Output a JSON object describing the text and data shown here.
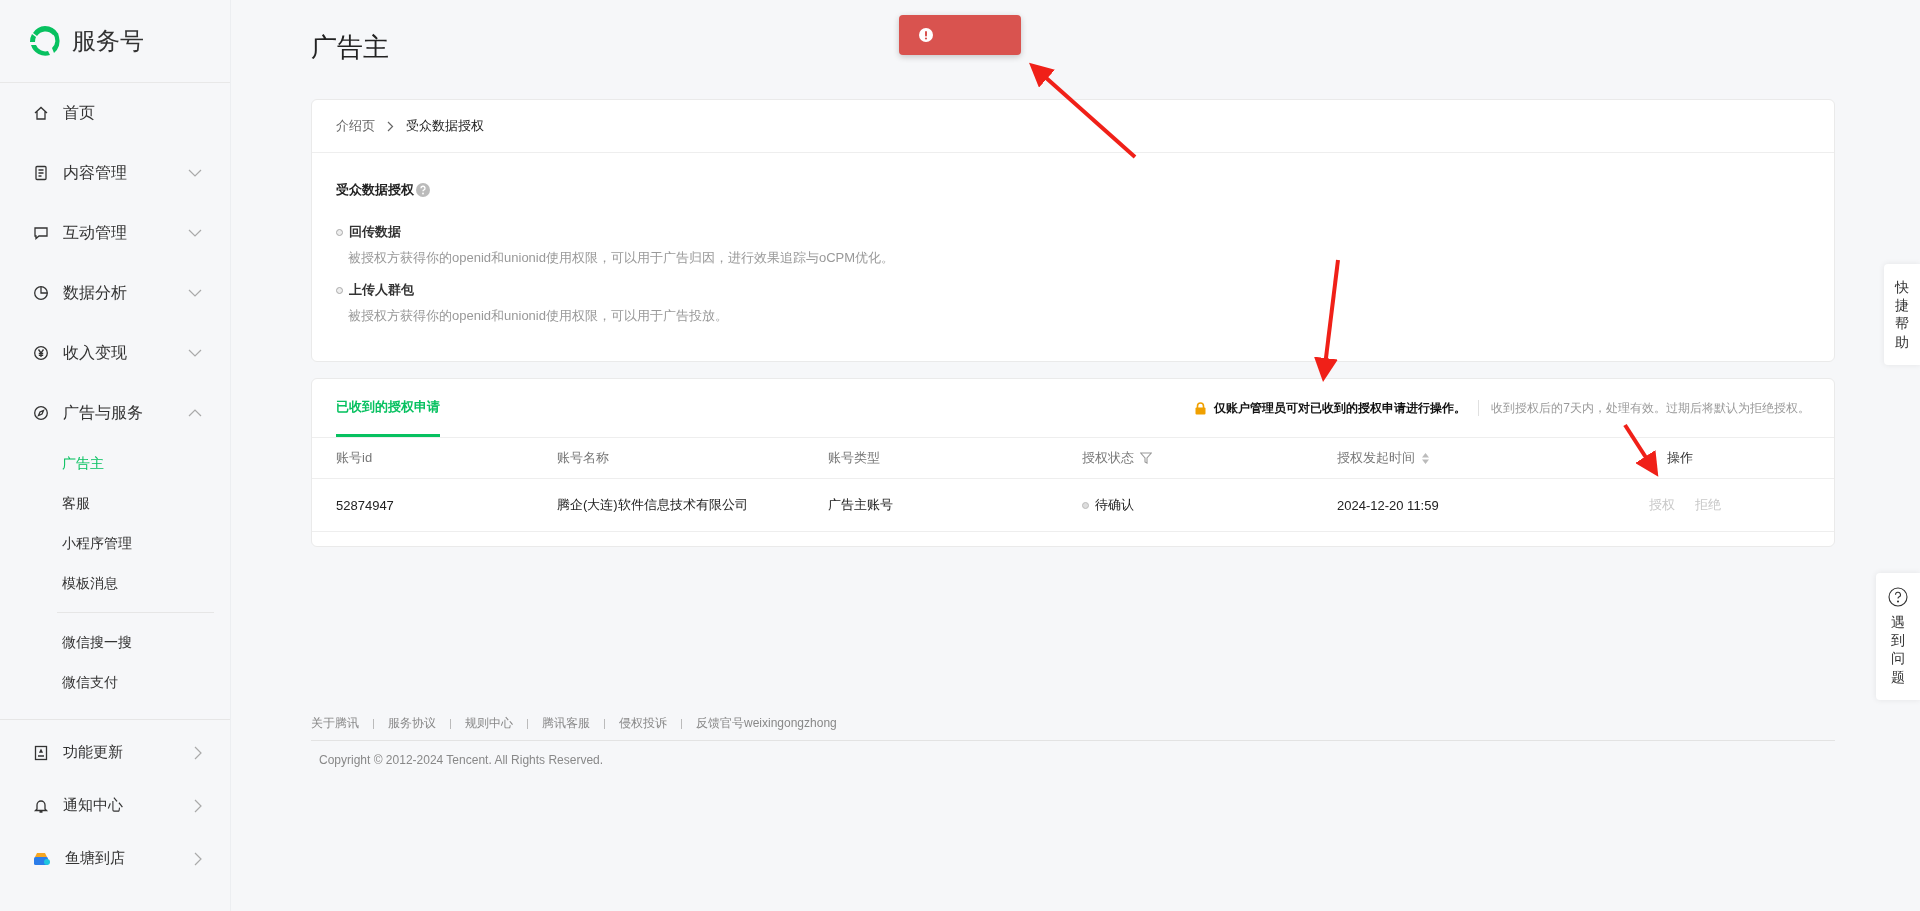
{
  "sidebar": {
    "logo": "服务号",
    "items": [
      {
        "label": "首页"
      },
      {
        "label": "内容管理",
        "expanded": false
      },
      {
        "label": "互动管理",
        "expanded": false
      },
      {
        "label": "数据分析",
        "expanded": false
      },
      {
        "label": "收入变现",
        "expanded": false
      },
      {
        "label": "广告与服务",
        "expanded": true,
        "children": [
          {
            "label": "广告主",
            "selected": true
          },
          {
            "label": "客服",
            "selected": false
          },
          {
            "label": "小程序管理",
            "selected": false
          },
          {
            "label": "模板消息",
            "selected": false
          },
          {
            "label": "微信搜一搜",
            "selected": false,
            "separated": true
          },
          {
            "label": "微信支付",
            "selected": false
          }
        ]
      }
    ],
    "bottom": [
      {
        "label": "功能更新"
      },
      {
        "label": "通知中心"
      },
      {
        "label": "鱼塘到店"
      }
    ]
  },
  "page_title": "广告主",
  "toast": {
    "kind": "error"
  },
  "intro_card": {
    "breadcrumb": [
      "介绍页",
      "受众数据授权"
    ],
    "heading": "受众数据授权",
    "points": [
      {
        "title": "回传数据",
        "text": "被授权方获得你的openid和unionid使用权限，可以用于广告归因，进行效果追踪与oCPM优化。"
      },
      {
        "title": "上传人群包",
        "text": "被授权方获得你的openid和unionid使用权限，可以用于广告投放。"
      }
    ]
  },
  "requests": {
    "tabs": [
      {
        "label": "已收到的授权申请",
        "selected": true
      }
    ],
    "notice": "仅账户管理员可对已收到的授权申请进行操作。",
    "hint": "收到授权后的7天内，处理有效。过期后将默认为拒绝授权。",
    "columns": [
      {
        "label": "账号id",
        "kind": "plain"
      },
      {
        "label": "账号名称",
        "kind": "plain"
      },
      {
        "label": "账号类型",
        "kind": "plain"
      },
      {
        "label": "授权状态",
        "kind": "filter"
      },
      {
        "label": "授权发起时间",
        "kind": "sort"
      },
      {
        "label": "操作",
        "kind": "plain"
      }
    ],
    "rows": [
      {
        "id": "52874947",
        "name": "腾企(大连)软件信息技术有限公司",
        "type": "广告主账号",
        "status": "待确认",
        "time": "2024-12-20 11:59",
        "actions": [
          {
            "label": "授权",
            "disabled": true
          },
          {
            "label": "拒绝",
            "disabled": true
          }
        ]
      }
    ]
  },
  "footer": {
    "links": [
      "关于腾讯",
      "服务协议",
      "规则中心",
      "腾讯客服",
      "侵权投诉",
      "反馈官号weixingongzhong"
    ],
    "copyright": "Copyright © 2012-2024 Tencent. All Rights Reserved."
  },
  "float_buttons": [
    {
      "label": "快捷帮助",
      "kind": "plain"
    },
    {
      "label": "遇到问题",
      "kind": "help"
    }
  ]
}
